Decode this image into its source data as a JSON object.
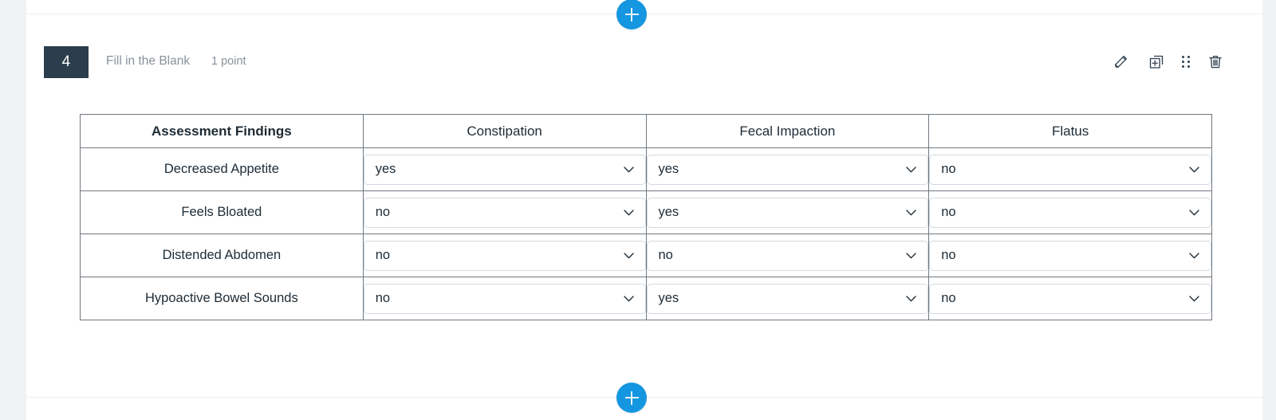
{
  "theme": {
    "accent_blue": "#1496e0",
    "question_badge_bg": "#2c3e4d",
    "meta_text": "#8a9199",
    "table_border": "#707880",
    "select_border": "#d2d9e0",
    "text": "#1d2b36"
  },
  "add_block_top": {
    "label": "+",
    "icon": "plus-icon"
  },
  "add_block_bottom": {
    "label": "+",
    "icon": "plus-icon"
  },
  "question": {
    "number": "4",
    "type": "Fill in the Blank",
    "points": "1 point",
    "tools": [
      {
        "name": "edit-icon",
        "title": "Edit"
      },
      {
        "name": "duplicate-icon",
        "title": "Duplicate"
      },
      {
        "name": "drag-handle-icon",
        "title": "Reorder"
      },
      {
        "name": "delete-icon",
        "title": "Delete"
      }
    ]
  },
  "matrix": {
    "headers": [
      "Assessment Findings",
      "Constipation",
      "Fecal Impaction",
      "Flatus"
    ],
    "rows": [
      {
        "label": "Decreased Appetite",
        "values": [
          "yes",
          "yes",
          "no"
        ]
      },
      {
        "label": "Feels Bloated",
        "values": [
          "no",
          "yes",
          "no"
        ]
      },
      {
        "label": "Distended Abdomen",
        "values": [
          "no",
          "no",
          "no"
        ]
      },
      {
        "label": "Hypoactive Bowel Sounds",
        "values": [
          "no",
          "yes",
          "no"
        ]
      }
    ],
    "options": [
      "yes",
      "no"
    ]
  }
}
